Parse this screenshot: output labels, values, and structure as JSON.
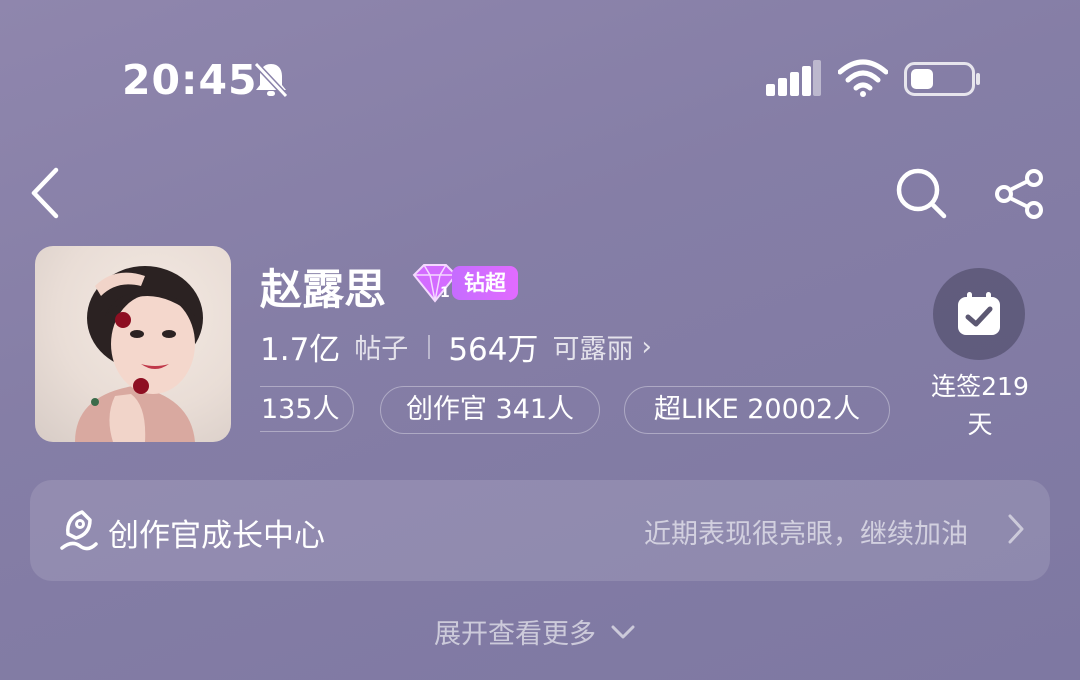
{
  "status_bar": {
    "time": "20:45"
  },
  "profile": {
    "name": "赵露思",
    "badge_label": "钻超",
    "badge_level": "1",
    "posts_count": "1.7亿",
    "posts_label": "帖子",
    "fans_count": "564万",
    "fans_label": "可露丽"
  },
  "tags": [
    {
      "label": "135人"
    },
    {
      "label": "创作官 341人"
    },
    {
      "label": "超LIKE 20002人"
    }
  ],
  "checkin": {
    "line1": "连签219",
    "line2": "天"
  },
  "growth_card": {
    "title": "创作官成长中心",
    "subtitle": "近期表现很亮眼，继续加油"
  },
  "expand_label": "展开查看更多",
  "icons": {
    "back": "back-arrow-icon",
    "search": "search-icon",
    "share": "share-icon",
    "checkin": "calendar-check-icon"
  },
  "colors": {
    "badge": "#d36cff",
    "background": "#8a82aa"
  }
}
